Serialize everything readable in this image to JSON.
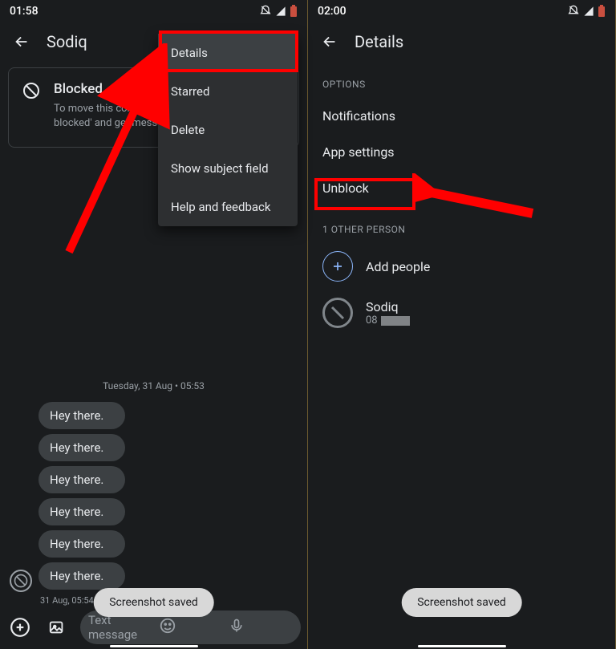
{
  "left": {
    "time": "01:58",
    "title": "Sodiq",
    "blocked": {
      "title": "Blocked",
      "sub": "To move this conversation out of archive, tap 'Not blocked' and get messages again."
    },
    "popup": {
      "details": "Details",
      "starred": "Starred",
      "delete": "Delete",
      "subject": "Show subject field",
      "help": "Help and feedback"
    },
    "timestamp": "Tuesday, 31 Aug • 05:53",
    "msgs": [
      "Hey there.",
      "Hey there.",
      "Hey there.",
      "Hey there.",
      "Hey there.",
      "Hey there."
    ],
    "mini_ts": "31 Aug, 05:54",
    "placeholder": "Text message",
    "toast": "Screenshot saved"
  },
  "right": {
    "time": "02:00",
    "title": "Details",
    "options_hdr": "OPTIONS",
    "notifications": "Notifications",
    "appsettings": "App settings",
    "unblock": "Unblock",
    "other_hdr": "1 OTHER PERSON",
    "add": "Add people",
    "person": {
      "name": "Sodiq",
      "num": "08"
    },
    "toast": "Screenshot saved"
  }
}
